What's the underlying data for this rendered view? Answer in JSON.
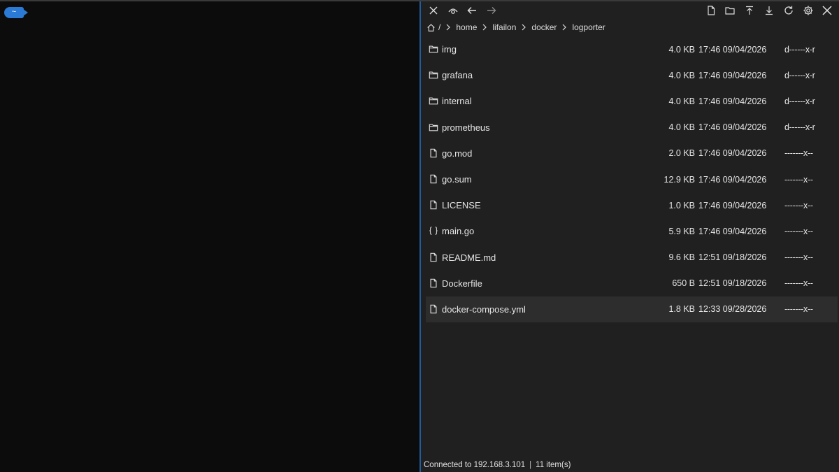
{
  "terminal": {
    "prompt_badge": "~"
  },
  "toolbar": {
    "icons": [
      "close-icon",
      "eye-icon",
      "arrow-left-icon",
      "arrow-right-icon",
      "new-file-icon",
      "new-folder-icon",
      "upload-icon",
      "download-icon",
      "refresh-icon",
      "settings-icon",
      "close-panel-icon"
    ]
  },
  "breadcrumb": {
    "root": "/",
    "segments": [
      "home",
      "lifailon",
      "docker",
      "logporter"
    ]
  },
  "files": [
    {
      "icon": "folder-icon",
      "name": "img",
      "size": "4.0 KB",
      "date": "17:46 09/04/2026",
      "perm": "d------x-r"
    },
    {
      "icon": "folder-icon",
      "name": "grafana",
      "size": "4.0 KB",
      "date": "17:46 09/04/2026",
      "perm": "d------x-r"
    },
    {
      "icon": "folder-icon",
      "name": "internal",
      "size": "4.0 KB",
      "date": "17:46 09/04/2026",
      "perm": "d------x-r"
    },
    {
      "icon": "folder-icon",
      "name": "prometheus",
      "size": "4.0 KB",
      "date": "17:46 09/04/2026",
      "perm": "d------x-r"
    },
    {
      "icon": "file-icon",
      "name": "go.mod",
      "size": "2.0 KB",
      "date": "17:46 09/04/2026",
      "perm": "-------x--"
    },
    {
      "icon": "file-icon",
      "name": "go.sum",
      "size": "12.9 KB",
      "date": "17:46 09/04/2026",
      "perm": "-------x--"
    },
    {
      "icon": "file-icon",
      "name": "LICENSE",
      "size": "1.0 KB",
      "date": "17:46 09/04/2026",
      "perm": "-------x--"
    },
    {
      "icon": "code-icon",
      "name": "main.go",
      "size": "5.9 KB",
      "date": "17:46 09/04/2026",
      "perm": "-------x--"
    },
    {
      "icon": "file-icon",
      "name": "README.md",
      "size": "9.6 KB",
      "date": "12:51 09/18/2026",
      "perm": "-------x--"
    },
    {
      "icon": "file-icon",
      "name": "Dockerfile",
      "size": "650 B",
      "date": "12:51 09/18/2026",
      "perm": "-------x--"
    },
    {
      "icon": "file-icon",
      "name": "docker-compose.yml",
      "size": "1.8 KB",
      "date": "12:33 09/28/2026",
      "perm": "-------x--"
    }
  ],
  "status": {
    "connection": "Connected to 192.168.3.101",
    "separator": "|",
    "count": "11 item(s)"
  },
  "colors": {
    "accent": "#2b7bd6",
    "divider": "#1f5d9e",
    "panel_bg": "#202020",
    "terminal_bg": "#0c0c0c",
    "row_highlight": "#2d2d2d"
  }
}
